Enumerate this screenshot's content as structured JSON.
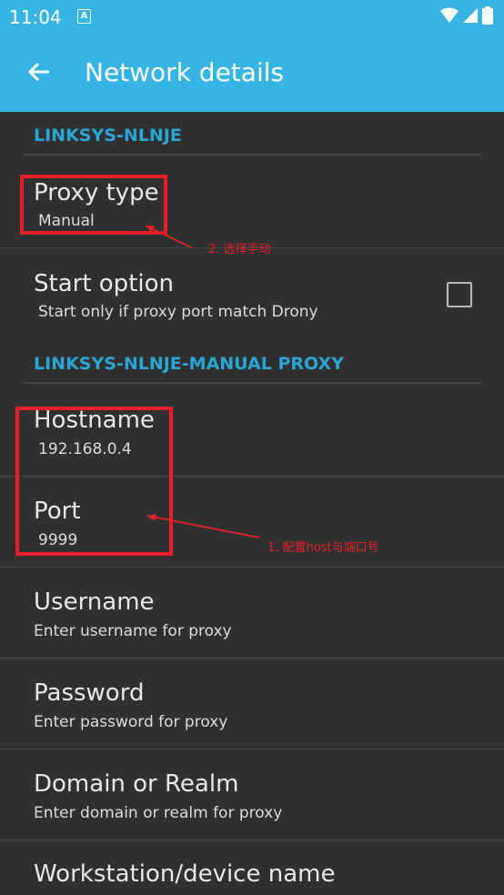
{
  "status_bar": {
    "time": "11:04",
    "notification_icon": "A"
  },
  "app_bar": {
    "title": "Network details",
    "back_icon": "arrow-left-icon"
  },
  "sections": {
    "network": "LINKSYS-NLNJE",
    "manual_proxy": "LINKSYS-NLNJE-MANUAL PROXY"
  },
  "settings": {
    "proxy_type": {
      "title": "Proxy type",
      "value": "Manual"
    },
    "start_option": {
      "title": "Start option",
      "value": "Start only if proxy port match Drony",
      "checked": false
    },
    "hostname": {
      "title": "Hostname",
      "value": "192.168.0.4"
    },
    "port": {
      "title": "Port",
      "value": "9999"
    },
    "username": {
      "title": "Username",
      "value": "Enter username for proxy"
    },
    "password": {
      "title": "Password",
      "value": "Enter password for proxy"
    },
    "domain": {
      "title": "Domain or Realm",
      "value": "Enter domain or realm for proxy"
    },
    "workstation": {
      "title": "Workstation/device name"
    }
  },
  "annotations": {
    "step2": "2. 选择手动",
    "step1": "1. 配置host与端口号"
  },
  "colors": {
    "accent": "#36b4e4",
    "section": "#2aa6d6",
    "background": "#303030",
    "annotation": "#e5202a"
  }
}
